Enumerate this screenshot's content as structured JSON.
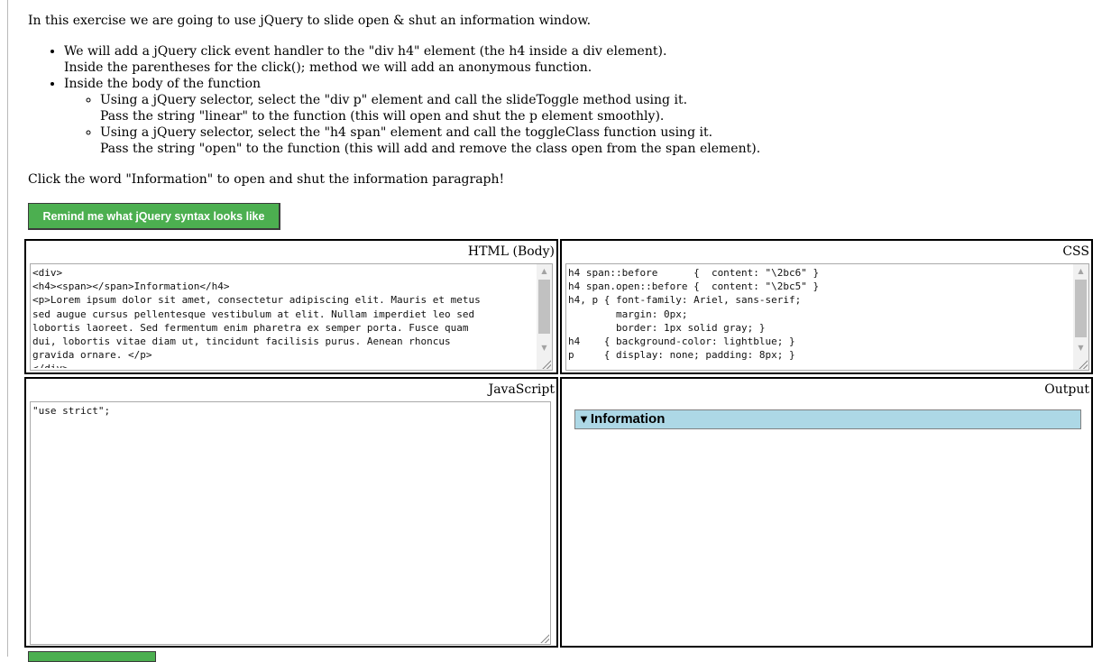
{
  "instructions": {
    "intro": "In this exercise we are going to use jQuery to slide open & shut an information window.",
    "bullet1_line1": "We will add a jQuery click event handler to the \"div h4\" element (the h4 inside a div element).",
    "bullet1_line2": "Inside the parentheses for the click(); method we will add an anonymous function.",
    "bullet2": "Inside the body of the function",
    "sub1_line1": "Using a jQuery selector, select the \"div p\" element and call the slideToggle method using it.",
    "sub1_line2": "Pass the string \"linear\" to the function (this will open and shut the p element smoothly).",
    "sub2_line1": "Using a jQuery selector, select the \"h4 span\" element and call the toggleClass function using it.",
    "sub2_line2": "Pass the string \"open\" to the function (this will add and remove the class open from the span element).",
    "click_note": "Click the word \"Information\" to open and shut the information paragraph!"
  },
  "remind_button": {
    "label": "Remind me what jQuery syntax looks like"
  },
  "panels": {
    "html": {
      "title": "HTML (Body)",
      "code": "<div>\n<h4><span></span>Information</h4>\n<p>Lorem ipsum dolor sit amet, consectetur adipiscing elit. Mauris et metus\nsed augue cursus pellentesque vestibulum at elit. Nullam imperdiet leo sed\nlobortis laoreet. Sed fermentum enim pharetra ex semper porta. Fusce quam\ndui, lobortis vitae diam ut, tincidunt facilisis purus. Aenean rhoncus\ngravida ornare. </p>\n</div>"
    },
    "css": {
      "title": "CSS",
      "code": "h4 span::before      {  content: \"\\2bc6\" }\nh4 span.open::before {  content: \"\\2bc5\" }\nh4, p { font-family: Ariel, sans-serif;\n        margin: 0px;\n        border: 1px solid gray; }\nh4    { background-color: lightblue; }\np     { display: none; padding: 8px; }"
    },
    "js": {
      "title": "JavaScript",
      "code": "\"use strict\";"
    },
    "output": {
      "title": "Output",
      "caret": "▼",
      "heading": "Information"
    }
  }
}
